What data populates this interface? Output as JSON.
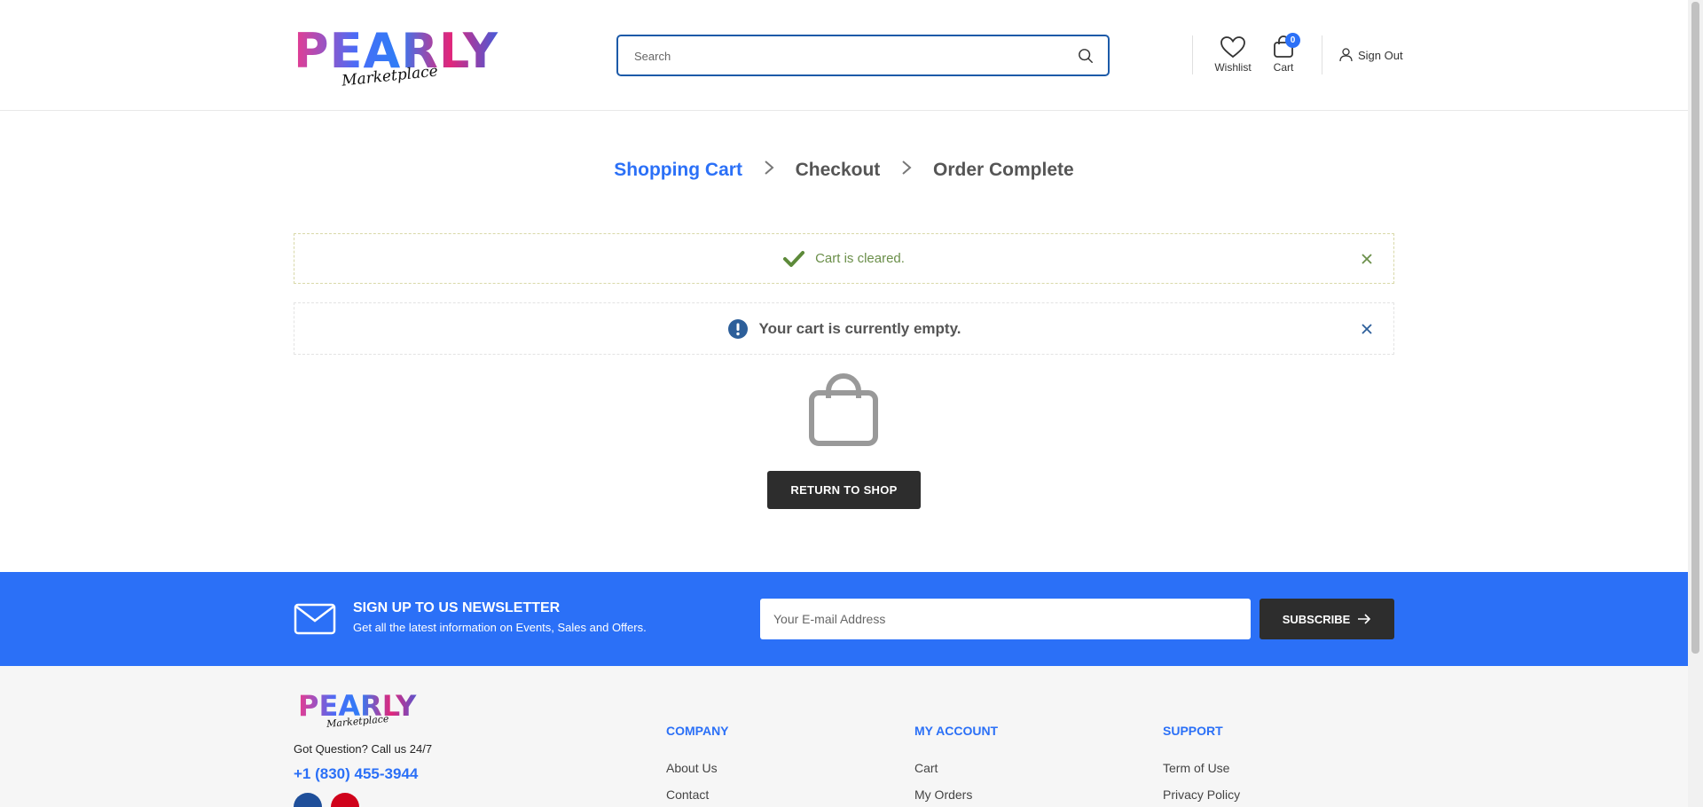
{
  "header": {
    "logo_text": "PEARLY",
    "logo_script": "Marketplace",
    "search_placeholder": "Search",
    "wishlist_label": "Wishlist",
    "cart_label": "Cart",
    "cart_count": "0",
    "signout_label": "Sign Out"
  },
  "steps": [
    {
      "label": "Shopping Cart",
      "active": true
    },
    {
      "label": "Checkout",
      "active": false
    },
    {
      "label": "Order Complete",
      "active": false
    }
  ],
  "alerts": {
    "success_text": "Cart is cleared.",
    "info_text": "Your cart is currently empty."
  },
  "empty_cart": {
    "button_label": "RETURN TO SHOP"
  },
  "newsletter": {
    "title": "SIGN UP TO US NEWSLETTER",
    "subtitle": "Get all the latest information on Events, Sales and Offers.",
    "email_placeholder": "Your E-mail Address",
    "button_label": "SUBSCRIBE"
  },
  "footer": {
    "logo_text": "PEARLY",
    "logo_script": "Marketplace",
    "question": "Got Question? Call us 24/7",
    "phone": "+1 (830) 455-3944",
    "columns": [
      {
        "title": "COMPANY",
        "links": [
          "About Us",
          "Contact"
        ]
      },
      {
        "title": "MY ACCOUNT",
        "links": [
          "Cart",
          "My Orders"
        ]
      },
      {
        "title": "SUPPORT",
        "links": [
          "Term of Use",
          "Privacy Policy"
        ]
      }
    ]
  },
  "colors": {
    "accent": "#2b70f7",
    "dark_button": "#2d2d2d",
    "success_text": "#6b8f4a",
    "info_icon": "#2d5f9a"
  },
  "icons": {
    "search": "search-icon",
    "wishlist": "heart-icon",
    "cart": "shopping-bag-icon",
    "signout": "user-icon",
    "step_separator": "chevron-right-icon",
    "success": "checkmark-icon",
    "info": "exclamation-circle-icon",
    "close": "close-icon",
    "empty_cart": "shopping-bag-icon",
    "newsletter": "envelope-icon",
    "subscribe": "arrow-right-icon",
    "facebook": "facebook-icon",
    "instagram": "instagram-icon"
  }
}
